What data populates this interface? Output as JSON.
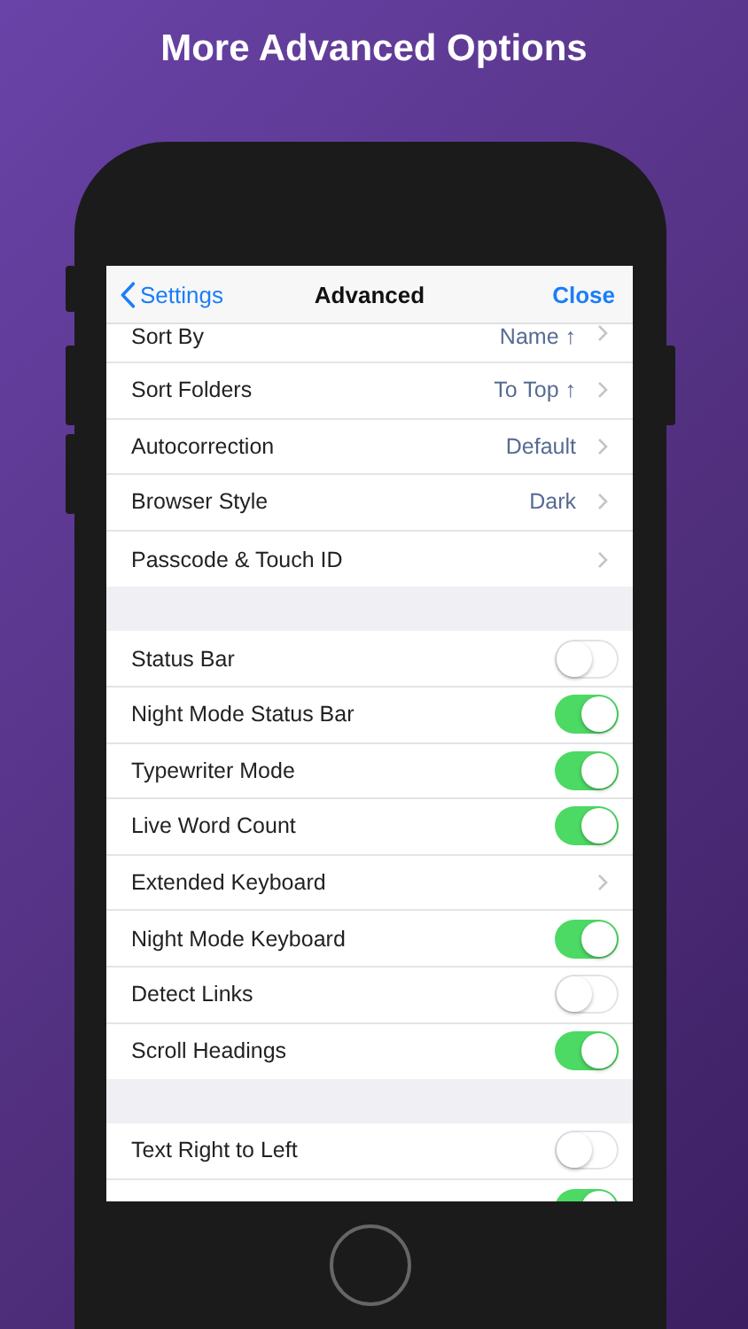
{
  "headline": "More Advanced Options",
  "nav": {
    "back": "Settings",
    "title": "Advanced",
    "action": "Close"
  },
  "groups": [
    {
      "rows": [
        {
          "kind": "value",
          "label": "Sort By",
          "value": "Name ↑"
        },
        {
          "kind": "value",
          "label": "Sort Folders",
          "value": "To Top ↑"
        },
        {
          "kind": "value",
          "label": "Autocorrection",
          "value": "Default"
        },
        {
          "kind": "value",
          "label": "Browser Style",
          "value": "Dark"
        },
        {
          "kind": "link",
          "label": "Passcode & Touch ID"
        }
      ]
    },
    {
      "rows": [
        {
          "kind": "toggle",
          "label": "Status Bar",
          "on": false
        },
        {
          "kind": "toggle",
          "label": "Night Mode Status Bar",
          "on": true
        },
        {
          "kind": "toggle",
          "label": "Typewriter Mode",
          "on": true
        },
        {
          "kind": "toggle",
          "label": "Live Word Count",
          "on": true
        },
        {
          "kind": "link",
          "label": "Extended Keyboard"
        },
        {
          "kind": "toggle",
          "label": "Night Mode Keyboard",
          "on": true
        },
        {
          "kind": "toggle",
          "label": "Detect Links",
          "on": false
        },
        {
          "kind": "toggle",
          "label": "Scroll Headings",
          "on": true
        }
      ]
    },
    {
      "rows": [
        {
          "kind": "toggle",
          "label": "Text Right to Left",
          "on": false
        },
        {
          "kind": "toggle",
          "on": true
        }
      ]
    }
  ]
}
